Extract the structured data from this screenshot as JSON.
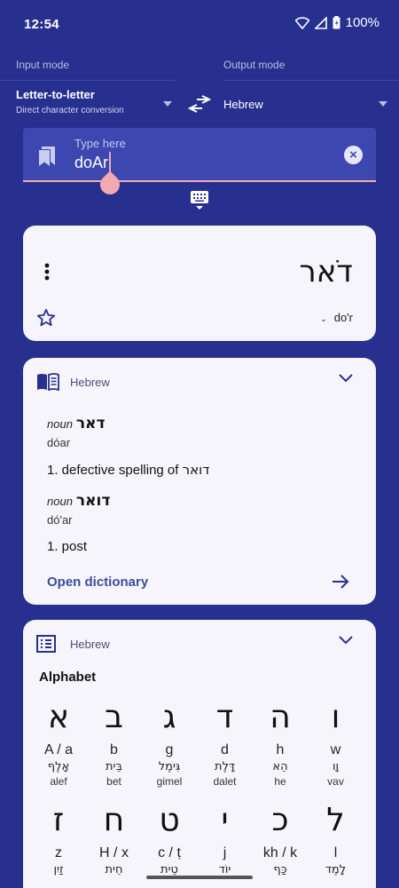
{
  "status": {
    "time": "12:54",
    "battery": "100%"
  },
  "modes": {
    "input_label": "Input mode",
    "output_label": "Output mode",
    "input_title": "Letter-to-letter",
    "input_sub": "Direct character conversion",
    "output_value": "Hebrew"
  },
  "input": {
    "placeholder": "Type here",
    "value": "doAr"
  },
  "result": {
    "text": "דֹאר",
    "transliteration": "do'r"
  },
  "dictionary": {
    "language": "Hebrew",
    "entries": [
      {
        "pos": "noun",
        "word": "דאר",
        "pron": "dóar",
        "def_prefix": "1. defective spelling of",
        "def_heb": "דואר"
      },
      {
        "pos": "noun",
        "word": "דואר",
        "pron": "dó'ar",
        "def_prefix": "1. post",
        "def_heb": ""
      }
    ],
    "open_label": "Open dictionary"
  },
  "alphabet": {
    "language": "Hebrew",
    "title": "Alphabet",
    "letters": [
      {
        "char": "א",
        "latin": "A / a",
        "heb": "אָלֶף",
        "name": "alef"
      },
      {
        "char": "ב",
        "latin": "b",
        "heb": "בֵּית",
        "name": "bet"
      },
      {
        "char": "ג",
        "latin": "g",
        "heb": "גִּימֶל",
        "name": "gimel"
      },
      {
        "char": "ד",
        "latin": "d",
        "heb": "דָּלֶת",
        "name": "dalet"
      },
      {
        "char": "ה",
        "latin": "h",
        "heb": "הֵא",
        "name": "he"
      },
      {
        "char": "ו",
        "latin": "w",
        "heb": "וָו",
        "name": "vav"
      },
      {
        "char": "ז",
        "latin": "z",
        "heb": "זַיִן",
        "name": ""
      },
      {
        "char": "ח",
        "latin": "H / x",
        "heb": "חֵית",
        "name": ""
      },
      {
        "char": "ט",
        "latin": "c / ṭ",
        "heb": "טֵית",
        "name": ""
      },
      {
        "char": "י",
        "latin": "j",
        "heb": "יוֹד",
        "name": ""
      },
      {
        "char": "כ",
        "latin": "kh / k",
        "heb": "כַּף",
        "name": ""
      },
      {
        "char": "ל",
        "latin": "l",
        "heb": "לָמֶד",
        "name": ""
      }
    ]
  },
  "colors": {
    "background": "#27308f",
    "accent": "#f2a9b2",
    "card": "#f7f5fc",
    "link": "#3f4d9c"
  }
}
